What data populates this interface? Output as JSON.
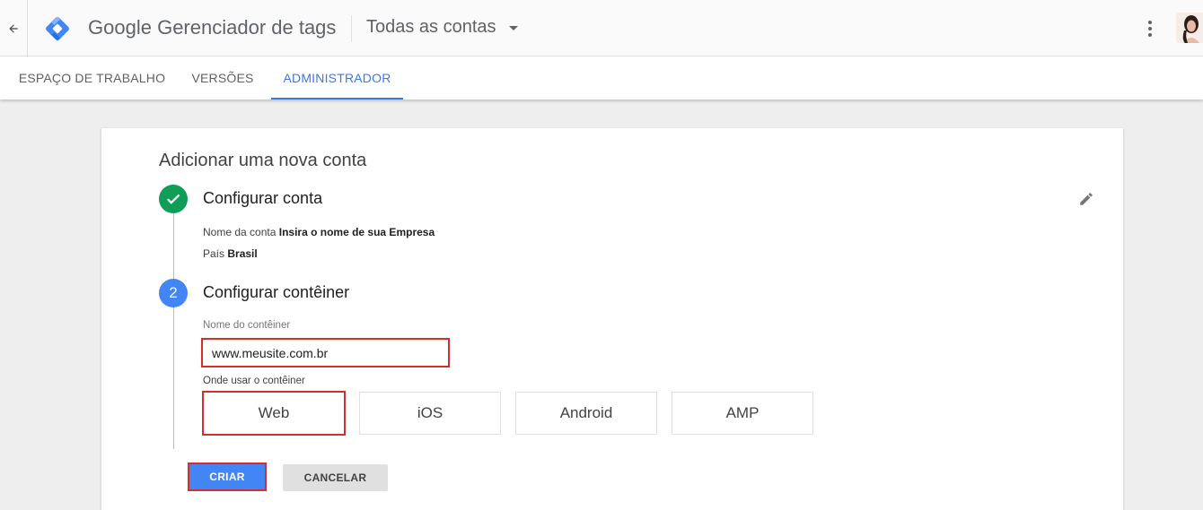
{
  "header": {
    "brand_google": "Google",
    "brand_product": "Gerenciador de tags",
    "account_select": "Todas as contas",
    "back_icon": "arrow-back-icon",
    "logo_icon": "gtm-logo",
    "menu_icon": "more-vert-icon"
  },
  "tabs": [
    {
      "label": "ESPAÇO DE TRABALHO",
      "active": false
    },
    {
      "label": "VERSÕES",
      "active": false
    },
    {
      "label": "ADMINISTRADOR",
      "active": true
    }
  ],
  "form": {
    "title": "Adicionar uma nova conta",
    "step1": {
      "number": "1",
      "title": "Configurar conta",
      "account_name_label": "Nome da conta",
      "account_name_value": "Insira o nome de sua Empresa",
      "country_label": "País",
      "country_value": "Brasil"
    },
    "step2": {
      "number": "2",
      "title": "Configurar contêiner",
      "container_name_label": "Nome do contêiner",
      "container_name_value": "www.meusite.com.br",
      "where_label": "Onde usar o contêiner",
      "platforms": [
        "Web",
        "iOS",
        "Android",
        "AMP"
      ],
      "selected_platform": "Web"
    },
    "create_button": "CRIAR",
    "cancel_button": "CANCELAR"
  },
  "colors": {
    "accent": "#3b78e7",
    "primary_button": "#4285f4",
    "success": "#0f9d58",
    "highlight": "#d32f2f"
  }
}
